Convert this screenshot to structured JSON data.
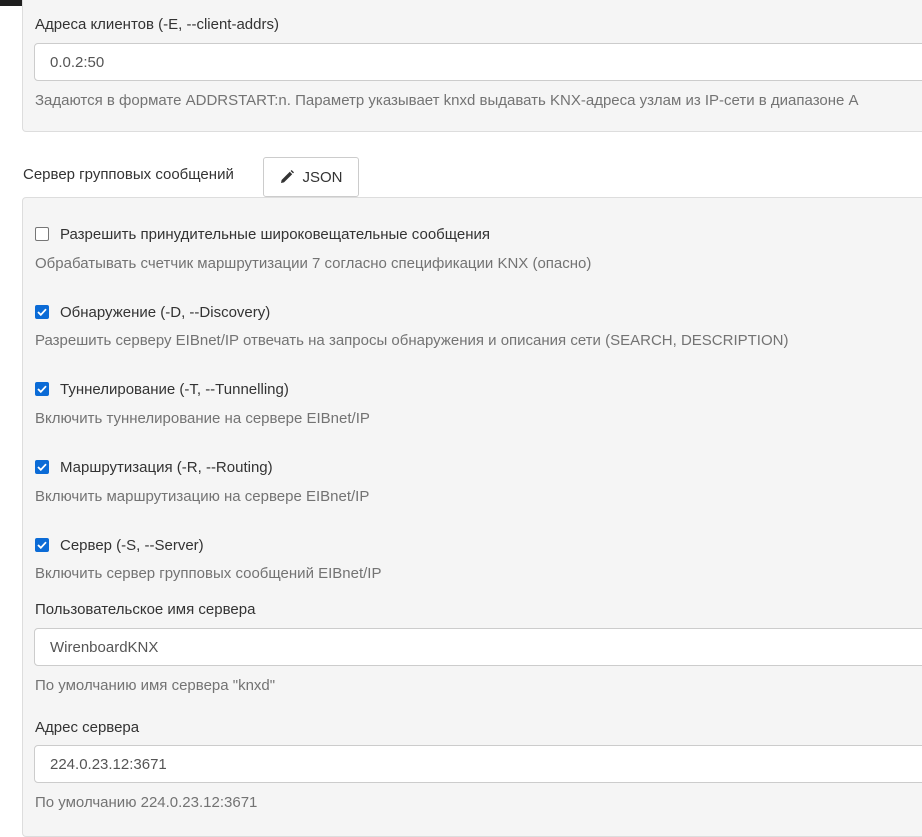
{
  "client_addrs": {
    "label": "Адреса клиентов (-E, --client-addrs)",
    "value": "0.0.2:50",
    "help": "Задаются в формате ADDRSTART:n. Параметр указывает knxd выдавать KNX-адреса узлам из IP-сети в диапазоне A"
  },
  "group_server": {
    "title": "Сервер групповых сообщений",
    "json_button": "JSON",
    "options": [
      {
        "label": "Разрешить принудительные широковещательные сообщения",
        "help": "Обрабатывать счетчик маршрутизации 7 согласно спецификации KNX (опасно)",
        "checked": false
      },
      {
        "label": "Обнаружение (-D, --Discovery)",
        "help": "Разрешить серверу EIBnet/IP отвечать на запросы обнаружения и описания сети (SEARCH, DESCRIPTION)",
        "checked": true
      },
      {
        "label": "Туннелирование (-T, --Tunnelling)",
        "help": "Включить туннелирование на сервере EIBnet/IP",
        "checked": true
      },
      {
        "label": "Маршрутизация (-R, --Routing)",
        "help": "Включить маршрутизацию на сервере EIBnet/IP",
        "checked": true
      },
      {
        "label": "Сервер (-S, --Server)",
        "help": "Включить сервер групповых сообщений EIBnet/IP",
        "checked": true
      }
    ],
    "server_name": {
      "label": "Пользовательское имя сервера",
      "value": "WirenboardKNX",
      "help": "По умолчанию имя сервера \"knxd\""
    },
    "server_address": {
      "label": "Адрес сервера",
      "value": "224.0.23.12:3671",
      "help": "По умолчанию 224.0.23.12:3671"
    }
  },
  "colors": {
    "checkbox_accent": "#0b6bd6",
    "panel_bg": "#f5f5f5",
    "help_text": "#737373"
  }
}
